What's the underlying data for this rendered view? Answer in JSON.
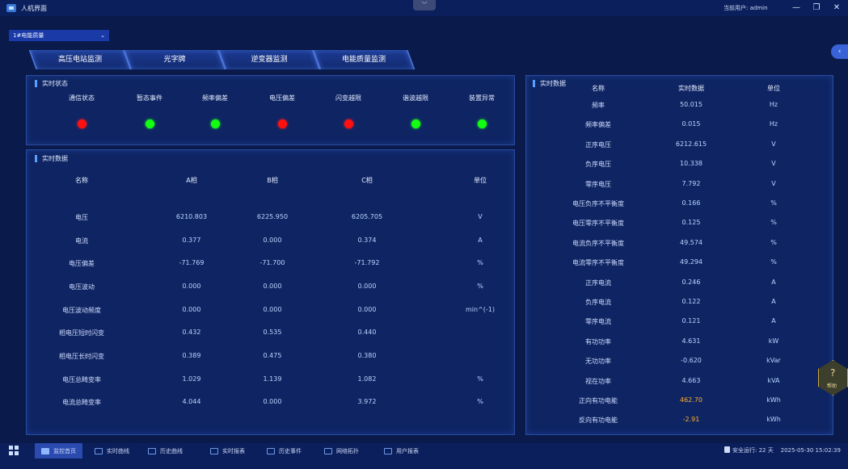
{
  "window": {
    "title": "人机界面",
    "dropdown_chevron": "﹀",
    "user_label": "当前用户: admin",
    "minimize": "—",
    "restore": "❐",
    "close": "✕"
  },
  "device_select": {
    "value": "1#电能质量",
    "chevron": "⌄"
  },
  "tabs": [
    {
      "label": "高压电站监测"
    },
    {
      "label": "光字牌"
    },
    {
      "label": "逆变器监测"
    },
    {
      "label": "电能质量监测"
    }
  ],
  "status_panel": {
    "title": "实时状态",
    "items": [
      {
        "label": "通信状态",
        "state": "red"
      },
      {
        "label": "暂态事件",
        "state": "green"
      },
      {
        "label": "频率偏差",
        "state": "green"
      },
      {
        "label": "电压偏差",
        "state": "red"
      },
      {
        "label": "闪变越限",
        "state": "red"
      },
      {
        "label": "谐波越限",
        "state": "green"
      },
      {
        "label": "装置异常",
        "state": "green"
      }
    ]
  },
  "phase_panel": {
    "title": "实时数据",
    "headers": [
      "名称",
      "A相",
      "B相",
      "C相",
      "单位"
    ],
    "rows": [
      [
        "电压",
        "6210.803",
        "6225.950",
        "6205.705",
        "V"
      ],
      [
        "电流",
        "0.377",
        "0.000",
        "0.374",
        "A"
      ],
      [
        "电压偏差",
        "-71.769",
        "-71.700",
        "-71.792",
        "%"
      ],
      [
        "电压波动",
        "0.000",
        "0.000",
        "0.000",
        "%"
      ],
      [
        "电压波动频度",
        "0.000",
        "0.000",
        "0.000",
        "min^(-1)"
      ],
      [
        "相电压短时闪变",
        "0.432",
        "0.535",
        "0.440",
        ""
      ],
      [
        "相电压长时闪变",
        "0.389",
        "0.475",
        "0.380",
        ""
      ],
      [
        "电压总畸变率",
        "1.029",
        "1.139",
        "1.082",
        "%"
      ],
      [
        "电流总畸变率",
        "4.044",
        "0.000",
        "3.972",
        "%"
      ]
    ]
  },
  "summary_panel": {
    "title": "实时数据",
    "headers": [
      "名称",
      "实时数据",
      "单位"
    ],
    "rows": [
      [
        "频率",
        "50.015",
        "Hz"
      ],
      [
        "频率偏差",
        "0.015",
        "Hz"
      ],
      [
        "正序电压",
        "6212.615",
        "V"
      ],
      [
        "负序电压",
        "10.338",
        "V"
      ],
      [
        "零序电压",
        "7.792",
        "V"
      ],
      [
        "电压负序不平衡度",
        "0.166",
        "%"
      ],
      [
        "电压零序不平衡度",
        "0.125",
        "%"
      ],
      [
        "电流负序不平衡度",
        "49.574",
        "%"
      ],
      [
        "电流零序不平衡度",
        "49.294",
        "%"
      ],
      [
        "正序电流",
        "0.246",
        "A"
      ],
      [
        "负序电流",
        "0.122",
        "A"
      ],
      [
        "零序电流",
        "0.121",
        "A"
      ],
      [
        "有功功率",
        "4.631",
        "kW"
      ],
      [
        "无功功率",
        "-0.620",
        "kVar"
      ],
      [
        "视在功率",
        "4.663",
        "kVA"
      ],
      [
        "正向有功电能",
        "462.70",
        "kWh"
      ],
      [
        "反向有功电能",
        "-2.91",
        "kWh"
      ]
    ],
    "highlight_color": "#ffae2a"
  },
  "bottom_nav": [
    {
      "label": "监控首页",
      "icon": "home-icon"
    },
    {
      "label": "实时曲线",
      "icon": "line-chart-icon"
    },
    {
      "label": "历史曲线",
      "icon": "history-chart-icon"
    },
    {
      "label": "实时报表",
      "icon": "report-icon"
    },
    {
      "label": "历史事件",
      "icon": "event-icon"
    },
    {
      "label": "网络拓扑",
      "icon": "topology-icon"
    },
    {
      "label": "用户报表",
      "icon": "user-report-icon"
    }
  ],
  "status_bar": {
    "safe_run": "安全运行: 22 天",
    "datetime": "2025-05-30 15:02:39"
  },
  "side": {
    "collapse": "‹",
    "help": "?",
    "help_text": "帮助"
  },
  "colors": {
    "red": "#ff1010",
    "green": "#12ff12",
    "accent": "#5aa0ff",
    "bg": "#0a1a4a"
  }
}
